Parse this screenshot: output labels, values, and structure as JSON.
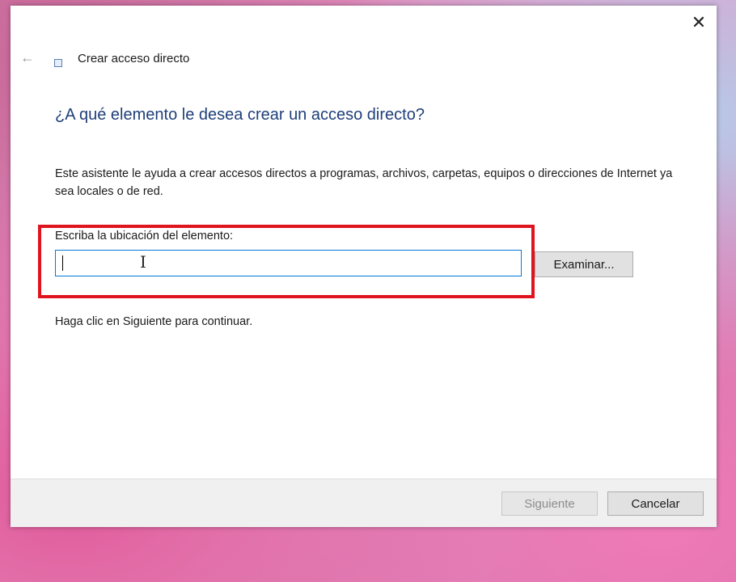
{
  "window": {
    "close_glyph": "✕"
  },
  "wizard": {
    "back_glyph": "←",
    "title": "Crear acceso directo",
    "icon": "shortcut-icon"
  },
  "main": {
    "heading": "¿A qué elemento le desea crear un acceso directo?",
    "description": "Este asistente le ayuda a crear accesos directos a programas, archivos, carpetas, equipos o direcciones de Internet ya sea locales o de red.",
    "location_label": "Escriba la ubicación del elemento:",
    "location_value": "",
    "browse_label": "Examinar...",
    "continue_text": "Haga clic en Siguiente para continuar."
  },
  "footer": {
    "next_label": "Siguiente",
    "cancel_label": "Cancelar"
  },
  "colors": {
    "heading": "#1e3f79",
    "highlight": "#e0141e",
    "input_border": "#0078d7"
  }
}
